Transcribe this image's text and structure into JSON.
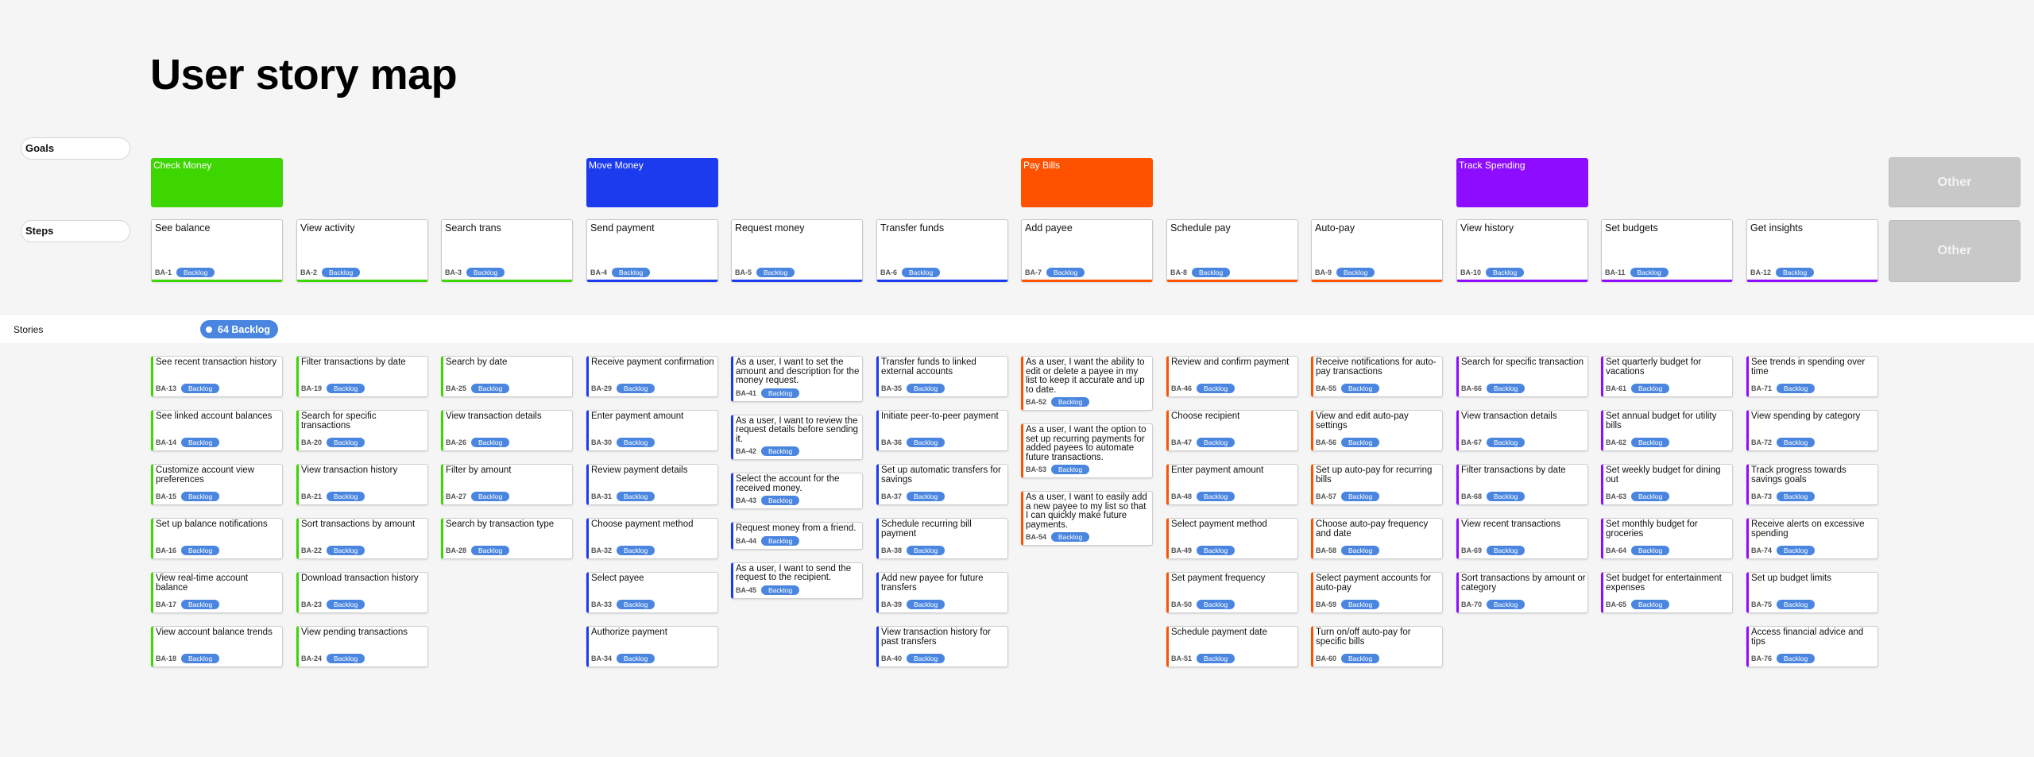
{
  "page": {
    "title": "User story map"
  },
  "row_labels": {
    "goals": "Goals",
    "steps": "Steps",
    "stories": "Stories"
  },
  "status_pill": {
    "count": "64",
    "label": "64 Backlog"
  },
  "badge_label": "Backlog",
  "other": {
    "goal": "Other",
    "step": "Other"
  },
  "goals": [
    {
      "label": "Check Money",
      "color": "#3dd600"
    },
    {
      "label": "Move Money",
      "color": "#1c3bef"
    },
    {
      "label": "Pay Bills",
      "color": "#fe5200"
    },
    {
      "label": "Track Spending",
      "color": "#8e0cff"
    }
  ],
  "steps": [
    {
      "label": "See balance",
      "id": "BA-1",
      "status": "Backlog",
      "goal": 0
    },
    {
      "label": "View activity",
      "id": "BA-2",
      "status": "Backlog",
      "goal": 0
    },
    {
      "label": "Search trans",
      "id": "BA-3",
      "status": "Backlog",
      "goal": 0
    },
    {
      "label": "Send payment",
      "id": "BA-4",
      "status": "Backlog",
      "goal": 1
    },
    {
      "label": "Request money",
      "id": "BA-5",
      "status": "Backlog",
      "goal": 1
    },
    {
      "label": "Transfer funds",
      "id": "BA-6",
      "status": "Backlog",
      "goal": 1
    },
    {
      "label": "Add payee",
      "id": "BA-7",
      "status": "Backlog",
      "goal": 2
    },
    {
      "label": "Schedule pay",
      "id": "BA-8",
      "status": "Backlog",
      "goal": 2
    },
    {
      "label": "Auto-pay",
      "id": "BA-9",
      "status": "Backlog",
      "goal": 2
    },
    {
      "label": "View history",
      "id": "BA-10",
      "status": "Backlog",
      "goal": 3
    },
    {
      "label": "Set budgets",
      "id": "BA-11",
      "status": "Backlog",
      "goal": 3
    },
    {
      "label": "Get insights",
      "id": "BA-12",
      "status": "Backlog",
      "goal": 3
    }
  ],
  "story_columns": [
    [
      {
        "text": "See recent transaction history",
        "id": "BA-13",
        "status": "Backlog"
      },
      {
        "text": "See linked account balances",
        "id": "BA-14",
        "status": "Backlog"
      },
      {
        "text": "Customize account view preferences",
        "id": "BA-15",
        "status": "Backlog"
      },
      {
        "text": "Set up balance notifications",
        "id": "BA-16",
        "status": "Backlog"
      },
      {
        "text": "View real-time account balance",
        "id": "BA-17",
        "status": "Backlog"
      },
      {
        "text": "View account balance trends",
        "id": "BA-18",
        "status": "Backlog"
      }
    ],
    [
      {
        "text": "Filter transactions by date",
        "id": "BA-19",
        "status": "Backlog"
      },
      {
        "text": "Search for specific transactions",
        "id": "BA-20",
        "status": "Backlog"
      },
      {
        "text": "View transaction history",
        "id": "BA-21",
        "status": "Backlog"
      },
      {
        "text": "Sort transactions by amount",
        "id": "BA-22",
        "status": "Backlog"
      },
      {
        "text": "Download transaction history",
        "id": "BA-23",
        "status": "Backlog"
      },
      {
        "text": "View pending transactions",
        "id": "BA-24",
        "status": "Backlog"
      }
    ],
    [
      {
        "text": "Search by date",
        "id": "BA-25",
        "status": "Backlog"
      },
      {
        "text": "View transaction details",
        "id": "BA-26",
        "status": "Backlog"
      },
      {
        "text": "Filter by amount",
        "id": "BA-27",
        "status": "Backlog"
      },
      {
        "text": "Search by transaction type",
        "id": "BA-28",
        "status": "Backlog"
      }
    ],
    [
      {
        "text": "Receive payment confirmation",
        "id": "BA-29",
        "status": "Backlog"
      },
      {
        "text": "Enter payment amount",
        "id": "BA-30",
        "status": "Backlog"
      },
      {
        "text": "Review payment details",
        "id": "BA-31",
        "status": "Backlog"
      },
      {
        "text": "Choose payment method",
        "id": "BA-32",
        "status": "Backlog"
      },
      {
        "text": "Select payee",
        "id": "BA-33",
        "status": "Backlog"
      },
      {
        "text": "Authorize payment",
        "id": "BA-34",
        "status": "Backlog"
      }
    ],
    [
      {
        "text": "As a user, I want to set the amount and description for the money request.",
        "id": "BA-41",
        "status": "Backlog"
      },
      {
        "text": "As a user, I want to review the request details before sending it.",
        "id": "BA-42",
        "status": "Backlog"
      },
      {
        "text": "Select the account for the received money.",
        "id": "BA-43",
        "status": "Backlog"
      },
      {
        "text": "Request money from a friend.",
        "id": "BA-44",
        "status": "Backlog"
      },
      {
        "text": "As a user, I want to send the request to the recipient.",
        "id": "BA-45",
        "status": "Backlog"
      }
    ],
    [
      {
        "text": "Transfer funds to linked external accounts",
        "id": "BA-35",
        "status": "Backlog"
      },
      {
        "text": "Initiate peer-to-peer payment",
        "id": "BA-36",
        "status": "Backlog"
      },
      {
        "text": "Set up automatic transfers for savings",
        "id": "BA-37",
        "status": "Backlog"
      },
      {
        "text": "Schedule recurring bill payment",
        "id": "BA-38",
        "status": "Backlog"
      },
      {
        "text": "Add new payee for future transfers",
        "id": "BA-39",
        "status": "Backlog"
      },
      {
        "text": "View transaction history for past transfers",
        "id": "BA-40",
        "status": "Backlog"
      }
    ],
    [
      {
        "text": "As a user, I want the ability to edit or delete a payee in my list to keep it accurate and up to date.",
        "id": "BA-52",
        "status": "Backlog"
      },
      {
        "text": "As a user, I want the option to set up recurring payments for added payees to automate future transactions.",
        "id": "BA-53",
        "status": "Backlog"
      },
      {
        "text": "As a user, I want to easily add a new payee to my list so that I can quickly make future payments.",
        "id": "BA-54",
        "status": "Backlog"
      }
    ],
    [
      {
        "text": "Review and confirm payment",
        "id": "BA-46",
        "status": "Backlog"
      },
      {
        "text": "Choose recipient",
        "id": "BA-47",
        "status": "Backlog"
      },
      {
        "text": "Enter payment amount",
        "id": "BA-48",
        "status": "Backlog"
      },
      {
        "text": "Select payment method",
        "id": "BA-49",
        "status": "Backlog"
      },
      {
        "text": "Set payment frequency",
        "id": "BA-50",
        "status": "Backlog"
      },
      {
        "text": "Schedule payment date",
        "id": "BA-51",
        "status": "Backlog"
      }
    ],
    [
      {
        "text": "Receive notifications for auto-pay transactions",
        "id": "BA-55",
        "status": "Backlog"
      },
      {
        "text": "View and edit auto-pay settings",
        "id": "BA-56",
        "status": "Backlog"
      },
      {
        "text": "Set up auto-pay for recurring bills",
        "id": "BA-57",
        "status": "Backlog"
      },
      {
        "text": "Choose auto-pay frequency and date",
        "id": "BA-58",
        "status": "Backlog"
      },
      {
        "text": "Select payment accounts for auto-pay",
        "id": "BA-59",
        "status": "Backlog"
      },
      {
        "text": "Turn on/off auto-pay for specific bills",
        "id": "BA-60",
        "status": "Backlog"
      }
    ],
    [
      {
        "text": "Search for specific transaction",
        "id": "BA-66",
        "status": "Backlog"
      },
      {
        "text": "View transaction details",
        "id": "BA-67",
        "status": "Backlog"
      },
      {
        "text": "Filter transactions by date",
        "id": "BA-68",
        "status": "Backlog"
      },
      {
        "text": "View recent transactions",
        "id": "BA-69",
        "status": "Backlog"
      },
      {
        "text": "Sort transactions by amount or category",
        "id": "BA-70",
        "status": "Backlog"
      }
    ],
    [
      {
        "text": "Set quarterly budget for vacations",
        "id": "BA-61",
        "status": "Backlog"
      },
      {
        "text": "Set annual budget for utility bills",
        "id": "BA-62",
        "status": "Backlog"
      },
      {
        "text": "Set weekly budget for dining out",
        "id": "BA-63",
        "status": "Backlog"
      },
      {
        "text": "Set monthly budget for groceries",
        "id": "BA-64",
        "status": "Backlog"
      },
      {
        "text": "Set budget for entertainment expenses",
        "id": "BA-65",
        "status": "Backlog"
      }
    ],
    [
      {
        "text": "See trends in spending over time",
        "id": "BA-71",
        "status": "Backlog"
      },
      {
        "text": "View spending by category",
        "id": "BA-72",
        "status": "Backlog"
      },
      {
        "text": "Track progress towards savings goals",
        "id": "BA-73",
        "status": "Backlog"
      },
      {
        "text": "Receive alerts on excessive spending",
        "id": "BA-74",
        "status": "Backlog"
      },
      {
        "text": "Set up budget limits",
        "id": "BA-75",
        "status": "Backlog"
      },
      {
        "text": "Access financial advice and tips",
        "id": "BA-76",
        "status": "Backlog"
      }
    ]
  ]
}
